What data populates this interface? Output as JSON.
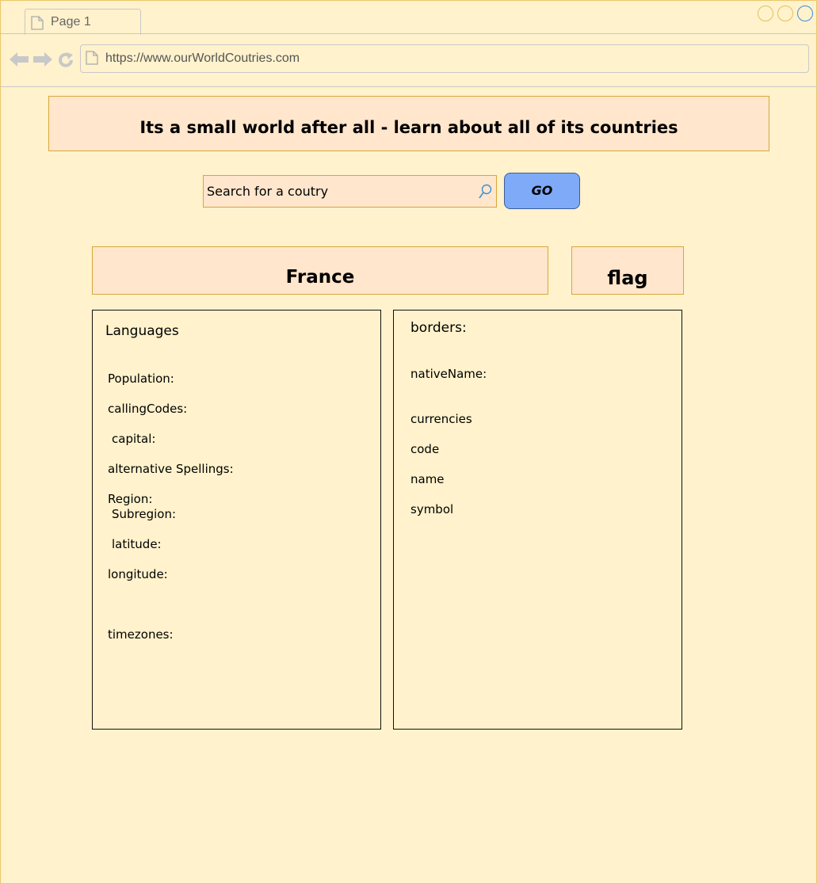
{
  "browser": {
    "tab_label": "Page 1",
    "url": "https://www.ourWorldCoutries.com"
  },
  "banner": {
    "title": "Its a small world after all - learn about all of its countries"
  },
  "search": {
    "placeholder": "Search for a coutry",
    "go_label": "GO"
  },
  "country": {
    "name": "France",
    "flag_label": "flag"
  },
  "left_panel": {
    "languages": "Languages",
    "population": "Population:",
    "calling_codes": "callingCodes:",
    "capital": "capital:",
    "alt_spellings": "alternative Spellings:",
    "region": "Region:",
    "subregion": "Subregion:",
    "latitude": "latitude:",
    "longitude": "longitude:",
    "timezones": "timezones:"
  },
  "right_panel": {
    "borders": "borders:",
    "native_name": "nativeName:",
    "currencies": "currencies",
    "code": "code",
    "name": "name",
    "symbol": "symbol"
  },
  "colors": {
    "background": "#fff2cc",
    "panel_fill": "#ffe6cc",
    "panel_border": "#d6a83a",
    "go_button": "#7eaaf8"
  },
  "icons": {
    "tab": "page-icon",
    "back": "back-arrow-icon",
    "forward": "forward-arrow-icon",
    "reload": "reload-icon",
    "url": "page-icon",
    "search": "search-icon"
  }
}
